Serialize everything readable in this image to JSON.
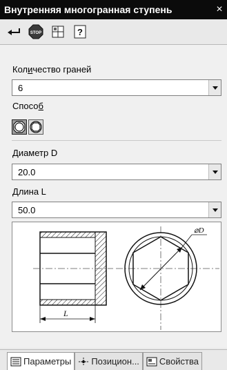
{
  "window": {
    "title": "Внутренняя многогранная ступень",
    "close_glyph": "×"
  },
  "toolbar": {
    "buttons": [
      {
        "icon": "enter-arrow-icon"
      },
      {
        "icon": "stop-icon",
        "label": "STOP"
      },
      {
        "icon": "grid-icon"
      },
      {
        "icon": "help-icon",
        "label": "?"
      }
    ]
  },
  "fields": {
    "faces": {
      "label_pre": "Кол",
      "label_ul": "и",
      "label_post": "чество граней",
      "value": "6"
    },
    "method": {
      "label_pre": "Спосо",
      "label_ul": "б",
      "label_post": ""
    },
    "diameter": {
      "label_pre": "",
      "label_ul": "Д",
      "label_post": "иаметр D",
      "value": "20.0"
    },
    "length": {
      "label_pre": "",
      "label_ul": "Д",
      "label_post": "лина L",
      "value": "50.0"
    }
  },
  "drawing": {
    "dim_length": "L",
    "dim_diameter": "⌀D"
  },
  "tabs": [
    {
      "label": "Параметры",
      "active": true,
      "icon": "parameters-tab-icon"
    },
    {
      "label": "Позицион...",
      "active": false,
      "icon": "position-tab-icon"
    },
    {
      "label": "Свойства",
      "active": false,
      "icon": "properties-tab-icon"
    }
  ],
  "colors": {
    "titlebar": "#0b0b0b",
    "panel": "#e9e9e9",
    "content": "#f0f0f0"
  }
}
